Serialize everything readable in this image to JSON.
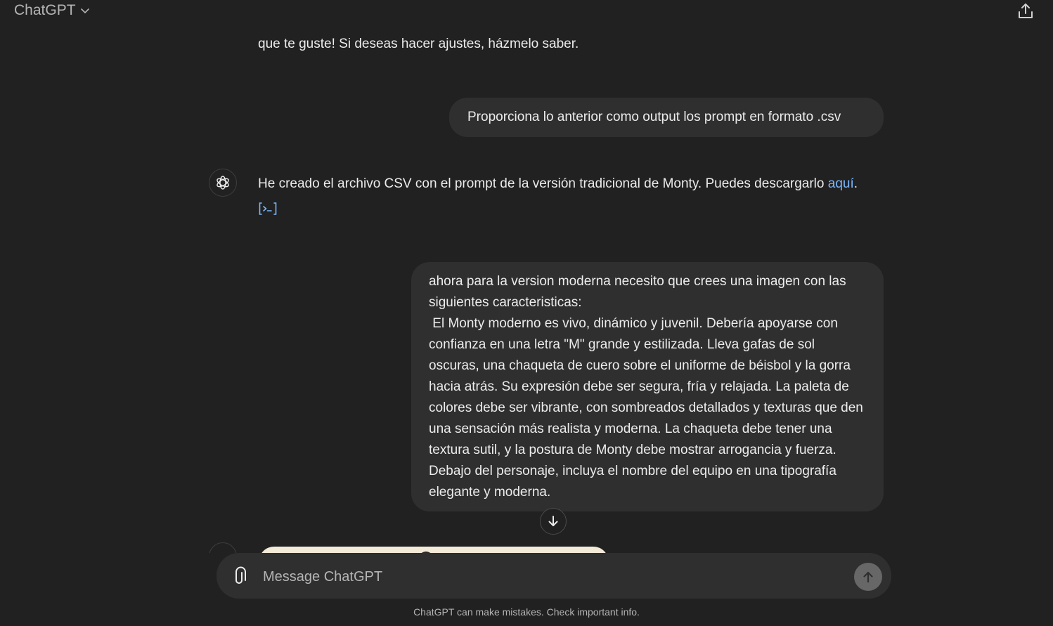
{
  "header": {
    "model_name": "ChatGPT",
    "model_chevron_icon": "chevron-down-icon",
    "share_icon": "share-upload-icon"
  },
  "conversation": {
    "assistant_partial_text": "que te guste! Si deseas hacer ajustes, házmelo saber.",
    "user_message_1": "Proporciona lo anterior como output los prompt en formato .csv",
    "assistant_message_2": {
      "text": "He creado el archivo CSV con el prompt de la versión tradicional de Monty. Puedes descargarlo ",
      "link_text": "aquí",
      "trailing": ".",
      "code_icon": "code-interpreter-icon"
    },
    "user_message_2": {
      "line_1": "ahora para la version moderna necesito que crees una imagen con las siguientes caracteristicas:",
      "line_2": " El Monty moderno es vivo, dinámico y juvenil. Debería apoyarse con confianza en una letra \"M\" grande y estilizada. Lleva gafas de sol oscuras, una chaqueta de cuero sobre el uniforme de béisbol y la gorra hacia atrás. Su expresión debe ser segura, fría y relajada. La paleta de colores debe ser vibrante, con sombreados detallados y texturas que den una sensación más realista y moderna. La chaqueta debe tener una textura sutil, y la postura de Monty debe mostrar arrogancia y fuerza. Debajo del personaje, incluya el nombre del equipo en una tipografía elegante y moderna."
    }
  },
  "composer": {
    "placeholder": "Message ChatGPT",
    "attach_icon": "paperclip-icon",
    "send_icon": "arrow-up-icon"
  },
  "footer": {
    "disclaimer": "ChatGPT can make mistakes. Check important info."
  },
  "colors": {
    "background": "#212121",
    "bubble": "#2f2f2f",
    "link": "#7ab7ff",
    "text": "#ececec",
    "muted": "#b4b4b4"
  }
}
